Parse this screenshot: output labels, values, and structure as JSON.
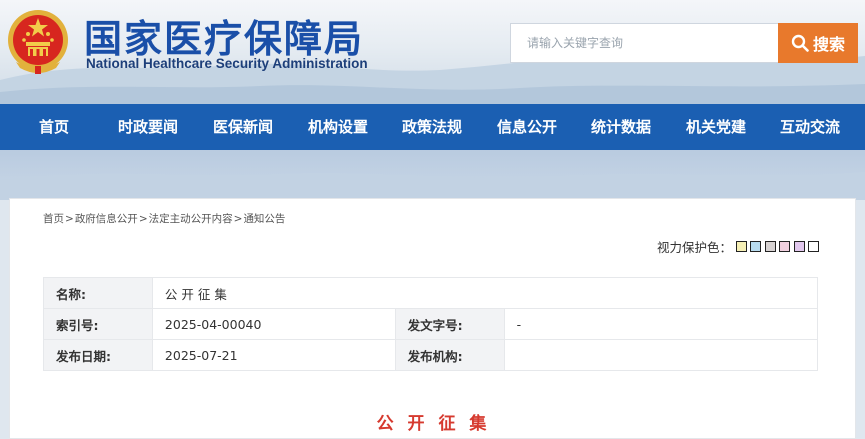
{
  "header": {
    "title_cn": "国家医疗保障局",
    "title_en": "National Healthcare Security Administration",
    "brand_color": "#1a4fa8"
  },
  "search": {
    "placeholder": "请输入关键字查询",
    "button_label": "搜索",
    "button_icon": "search-icon",
    "button_color": "#e8792c"
  },
  "nav": {
    "color": "#1b5fb2",
    "items": [
      {
        "label": "首页"
      },
      {
        "label": "时政要闻"
      },
      {
        "label": "医保新闻"
      },
      {
        "label": "机构设置"
      },
      {
        "label": "政策法规"
      },
      {
        "label": "信息公开"
      },
      {
        "label": "统计数据"
      },
      {
        "label": "机关党建"
      },
      {
        "label": "互动交流"
      }
    ]
  },
  "breadcrumb": {
    "items": [
      "首页",
      "政府信息公开",
      "法定主动公开内容",
      "通知公告"
    ],
    "separator": ">"
  },
  "vision": {
    "label": "视力保护色：",
    "swatches": [
      "#f6f0b6",
      "#b9dcef",
      "#d7d2d2",
      "#f1d0df",
      "#e2c8ee",
      "#ffffff"
    ]
  },
  "meta": {
    "name_label": "名称:",
    "name_value": "公 开 征 集",
    "index_label": "索引号:",
    "index_value": "2025-04-00040",
    "docno_label": "发文字号:",
    "docno_value": "-",
    "date_label": "发布日期:",
    "date_value": "2025-07-21",
    "org_label": "发布机构:",
    "org_value": ""
  },
  "document": {
    "title": "公 开 征 集",
    "title_color": "#d63a2f"
  }
}
